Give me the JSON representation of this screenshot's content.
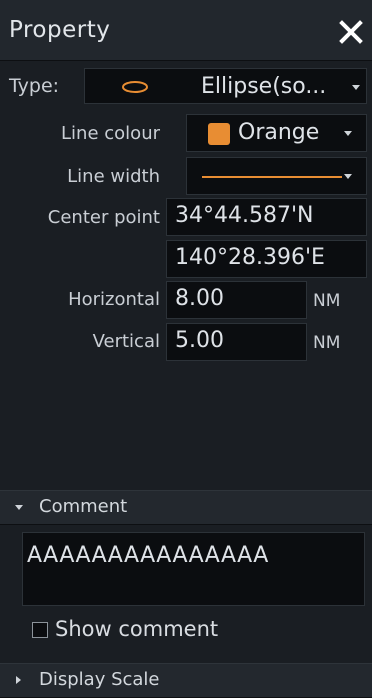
{
  "header": {
    "title": "Property"
  },
  "type": {
    "label": "Type:",
    "value": "Ellipse(so...",
    "icon": "ellipse-icon"
  },
  "line_colour": {
    "label": "Line colour",
    "value": "Orange",
    "swatch_color": "#e88d33"
  },
  "line_width": {
    "label": "Line width"
  },
  "center_point": {
    "label": "Center point",
    "lat": "34°44.587'N",
    "lon": "140°28.396'E"
  },
  "horizontal": {
    "label": "Horizontal",
    "value": "8.00",
    "unit": "NM"
  },
  "vertical": {
    "label": "Vertical",
    "value": "5.00",
    "unit": "NM"
  },
  "comment": {
    "section_label": "Comment",
    "text": "AAAAAAAAAAAAAAA",
    "show_label": "Show comment",
    "show_checked": false
  },
  "display_scale": {
    "section_label": "Display Scale"
  }
}
